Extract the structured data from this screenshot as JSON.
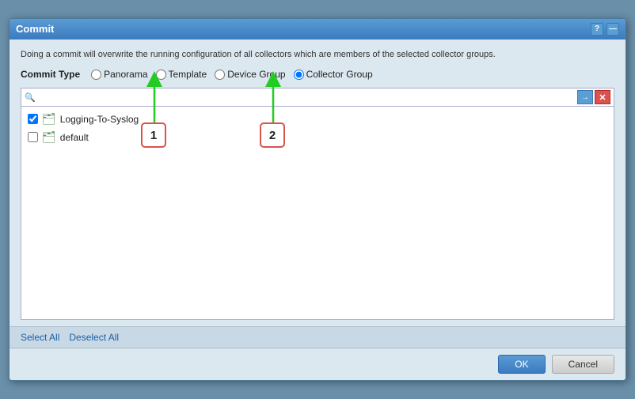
{
  "dialog": {
    "title": "Commit",
    "info_text": "Doing a commit will overwrite the running configuration of all collectors which are members of the selected collector groups.",
    "commit_type_label": "Commit Type",
    "radio_options": [
      {
        "id": "panorama",
        "label": "Panorama",
        "checked": false
      },
      {
        "id": "template",
        "label": "Template",
        "checked": false
      },
      {
        "id": "device-group",
        "label": "Device Group",
        "checked": false
      },
      {
        "id": "collector-group",
        "label": "Collector Group",
        "checked": true
      }
    ],
    "search_placeholder": "",
    "list_items": [
      {
        "id": "item1",
        "label": "Logging-To-Syslog",
        "checked": true
      },
      {
        "id": "item2",
        "label": "default",
        "checked": false
      }
    ],
    "footer": {
      "select_all": "Select All",
      "deselect_all": "Deselect All"
    },
    "buttons": {
      "ok": "OK",
      "cancel": "Cancel"
    }
  },
  "icons": {
    "search": "🔍",
    "help": "?",
    "minimize": "—",
    "arrow_right": "→",
    "close_x": "✕",
    "folder": "🗂"
  }
}
